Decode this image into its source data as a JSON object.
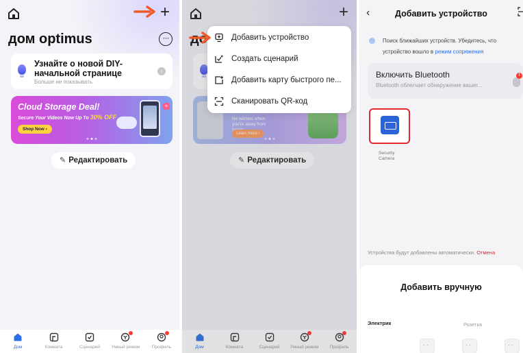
{
  "panel1": {
    "home_title": "дом optimus",
    "diy_card": {
      "title": "Узнайте о новой DIY-начальной странице",
      "subtitle": "Больше не показывать"
    },
    "promo": {
      "title": "Cloud Storage Deal!",
      "subtitle_prefix": "Secure Your Videos Now Up To ",
      "subtitle_highlight": "30% OFF",
      "button": "Shop Now ›"
    },
    "edit_button": "Редактировать"
  },
  "panel2": {
    "home_title_peek": "до",
    "menu": [
      {
        "label": "Добавить устройство",
        "icon": "add-device-icon"
      },
      {
        "label": "Создать сценарий",
        "icon": "create-scene-icon"
      },
      {
        "label": "Добавить карту быстрого пе...",
        "icon": "add-card-icon"
      },
      {
        "label": "Сканировать QR-код",
        "icon": "scan-qr-icon"
      }
    ],
    "promo": {
      "text": "No worries when you're away from home",
      "button": "Learn more ›"
    },
    "edit_button": "Редактировать"
  },
  "panel3": {
    "title": "Добавить устройство",
    "search_text": "Поиск ближайших устройств. Убедитесь, что устройство вошло в",
    "search_link": "режим сопряжения",
    "bluetooth": {
      "title": "Включить Bluetooth",
      "subtitle": "Bluetooth облегчает обнаружение вашег..."
    },
    "device_label": "Security Camera",
    "auto_text": "Устройства будут добавлены автоматически.",
    "auto_cancel": "Отмена",
    "manual_title": "Добавить вручную",
    "category_left": "Электрик",
    "category_right": "Розетка"
  },
  "tabs": [
    {
      "label": "Дом",
      "icon": "home-tab-icon"
    },
    {
      "label": "Комната",
      "icon": "room-tab-icon"
    },
    {
      "label": "Сценарий",
      "icon": "scene-tab-icon"
    },
    {
      "label": "Умный режим",
      "icon": "smart-mode-tab-icon"
    },
    {
      "label": "Профиль",
      "icon": "profile-tab-icon"
    }
  ],
  "colors": {
    "accent": "#2c6fe6",
    "arrow": "#f05a28",
    "highlight_border": "#e0262f",
    "badge": "#ff3b30"
  }
}
